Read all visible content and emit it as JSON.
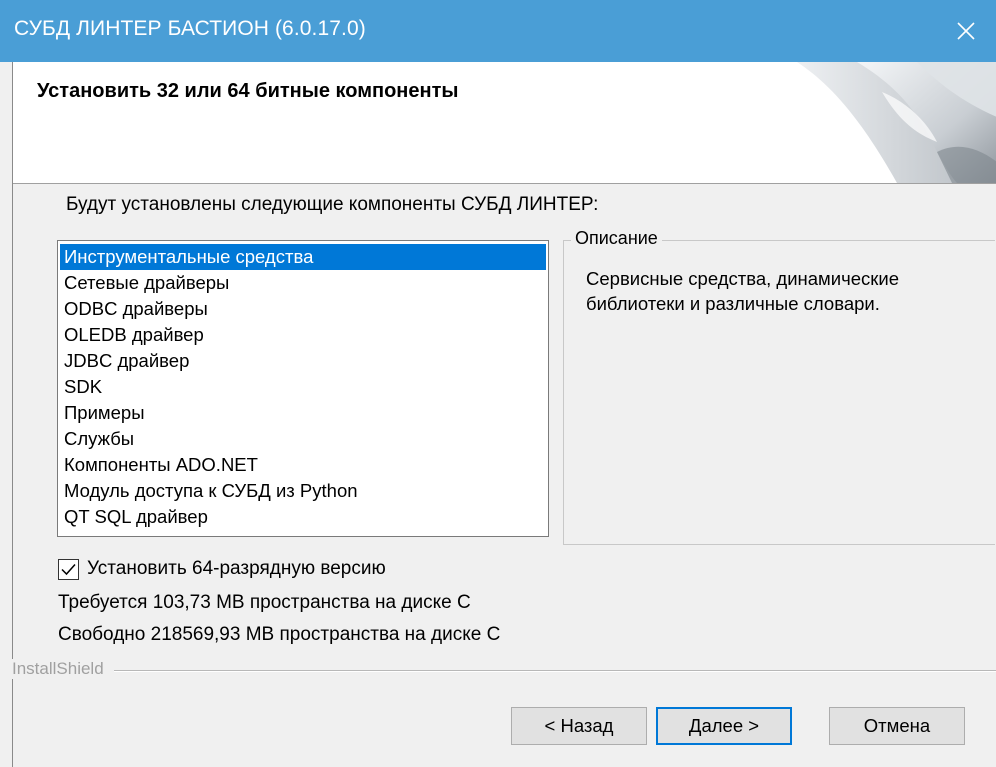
{
  "window": {
    "title": "СУБД ЛИНТЕР БАСТИОН (6.0.17.0)",
    "close_icon": "close-icon",
    "titlebar_color": "#4a9ed6"
  },
  "header": {
    "heading": "Установить 32 или 64 битные компоненты"
  },
  "intro_text": "Будут установлены следующие компоненты СУБД ЛИНТЕР:",
  "components": {
    "items": [
      "Инструментальные средства",
      "Сетевые драйверы",
      "ODBC драйверы",
      "OLEDB драйвер",
      "JDBC драйвер",
      "SDK",
      "Примеры",
      "Службы",
      "Компоненты ADO.NET",
      "Модуль доступа к СУБД из Python",
      "QT SQL драйвер"
    ],
    "selected": "Инструментальные средства",
    "selection_color": "#0078d7"
  },
  "description": {
    "legend": "Описание",
    "text": "Сервисные средства, динамические библиотеки и различные словари."
  },
  "options": {
    "install64_label": "Установить 64-разрядную версию",
    "install64_checked": true
  },
  "disk": {
    "required": "Требуется 103,73 MB пространства на диске C",
    "free": "Свободно 218569,93 MB пространства на диске C"
  },
  "branding": "InstallShield",
  "buttons": {
    "back": "< Назад",
    "next": "Далее >",
    "cancel": "Отмена"
  }
}
